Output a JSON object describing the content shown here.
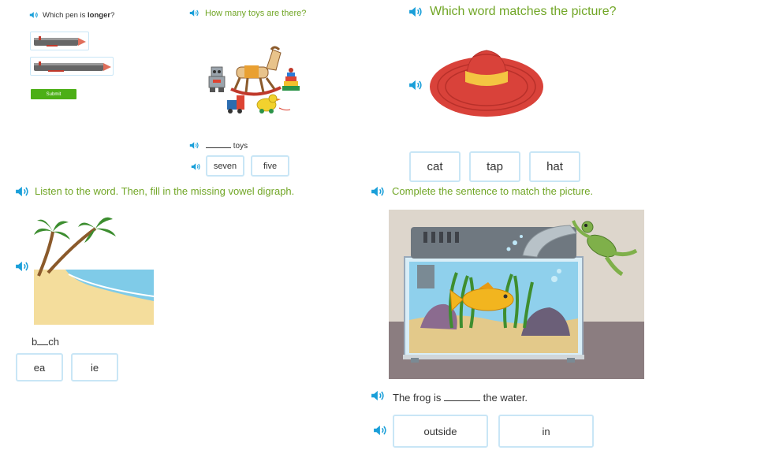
{
  "q1": {
    "prefix": "Which pen is ",
    "bold": "longer",
    "suffix": "?",
    "submit_label": "Submit"
  },
  "q2": {
    "question": "How many toys are there?",
    "sentence_suffix": "toys",
    "choices": [
      "seven",
      "five"
    ]
  },
  "q3": {
    "question": "Which word matches the picture?",
    "choices": [
      "cat",
      "tap",
      "hat"
    ]
  },
  "q4": {
    "question": "Listen to the word. Then, fill in the missing vowel digraph.",
    "word_start": "b",
    "word_end": "ch",
    "choices": [
      "ea",
      "ie"
    ]
  },
  "q5": {
    "question": "Complete the sentence to match the picture.",
    "sentence_start": "The frog is",
    "sentence_end": "the water.",
    "choices": [
      "outside",
      "in"
    ]
  },
  "colors": {
    "question_green": "#71a626",
    "speaker_blue": "#1a9fd9",
    "choice_border": "#c9e6f6",
    "submit_green": "#4caf16"
  }
}
